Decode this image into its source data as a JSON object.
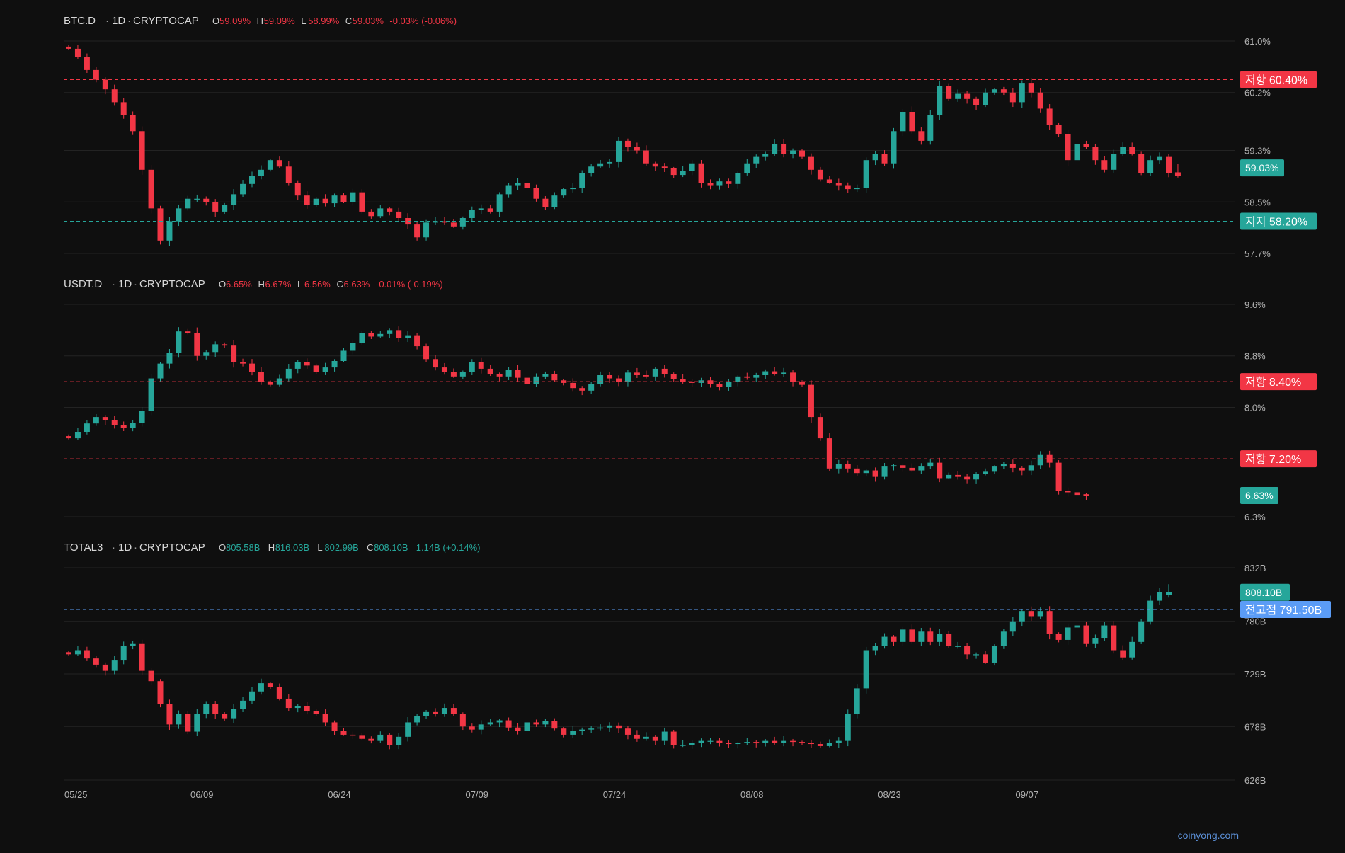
{
  "theme": {
    "up": "#26a69a",
    "down": "#f23645",
    "grid": "#232323",
    "axis_text": "#b2b2b2",
    "support_color": "#26a69a",
    "resistance_color": "#f23645",
    "prev_high_color": "#5b9cf6"
  },
  "x_axis": {
    "labels": [
      "05/25",
      "06/09",
      "06/24",
      "07/09",
      "07/24",
      "08/08",
      "08/23",
      "09/07"
    ],
    "label_index": [
      0,
      15,
      30,
      45,
      60,
      75,
      90,
      105
    ]
  },
  "watermark": "coinyong.com",
  "chart_data": [
    {
      "type": "candlestick",
      "symbol": "BTC.D",
      "interval": "1D",
      "exchange": "CRYPTOCAP",
      "ohlc_label": {
        "o": "59.09%",
        "h": "59.09%",
        "l": "58.99%",
        "c": "59.03%",
        "chg": "-0.03% (-0.06%)",
        "direction": "down"
      },
      "y_ticks": [
        {
          "v": 61.0,
          "label": "61.0%"
        },
        {
          "v": 60.2,
          "label": "60.2%"
        },
        {
          "v": 59.3,
          "label": "59.3%"
        },
        {
          "v": 58.5,
          "label": "58.5%"
        },
        {
          "v": 57.7,
          "label": "57.7%"
        }
      ],
      "ylim": [
        57.7,
        61.0
      ],
      "levels": [
        {
          "label": "저항 60.40%",
          "value": 60.4,
          "kind": "resistance"
        },
        {
          "label": "지지 58.20%",
          "value": 58.2,
          "kind": "support"
        }
      ],
      "last_price": {
        "label": "59.03%",
        "value": 59.03,
        "direction": "up"
      },
      "closes": [
        60.88,
        60.75,
        60.55,
        60.4,
        60.25,
        60.05,
        59.85,
        59.6,
        59.0,
        58.4,
        57.9,
        58.2,
        58.4,
        58.55,
        58.55,
        58.5,
        58.35,
        58.45,
        58.62,
        58.78,
        58.9,
        59.0,
        59.15,
        59.05,
        58.8,
        58.6,
        58.45,
        58.55,
        58.48,
        58.6,
        58.5,
        58.65,
        58.35,
        58.28,
        58.4,
        58.35,
        58.25,
        58.15,
        57.95,
        58.18,
        58.2,
        58.18,
        58.12,
        58.25,
        58.38,
        58.4,
        58.35,
        58.62,
        58.75,
        58.8,
        58.72,
        58.55,
        58.42,
        58.6,
        58.7,
        58.72,
        58.95,
        59.05,
        59.1,
        59.12,
        59.45,
        59.35,
        59.3,
        59.1,
        59.05,
        59.02,
        58.92,
        58.98,
        59.1,
        58.8,
        58.75,
        58.82,
        58.78,
        58.95,
        59.1,
        59.2,
        59.25,
        59.4,
        59.25,
        59.3,
        59.2,
        59.0,
        58.85,
        58.8,
        58.75,
        58.7,
        58.72,
        59.15,
        59.25,
        59.1,
        59.6,
        59.9,
        59.6,
        59.45,
        59.85,
        60.3,
        60.1,
        60.18,
        60.1,
        60.0,
        60.2,
        60.25,
        60.2,
        60.05,
        60.35,
        60.2,
        59.95,
        59.7,
        59.55,
        59.15,
        59.4,
        59.35,
        59.15,
        59.0,
        59.25,
        59.35,
        59.25,
        58.95,
        59.15,
        59.2,
        58.95,
        58.9
      ],
      "last_candle": {
        "o": 58.96,
        "h": 59.09,
        "l": 58.88,
        "c": 58.9
      }
    },
    {
      "type": "candlestick",
      "symbol": "USDT.D",
      "interval": "1D",
      "exchange": "CRYPTOCAP",
      "ohlc_label": {
        "o": "6.65%",
        "h": "6.67%",
        "l": "6.56%",
        "c": "6.63%",
        "chg": "-0.01% (-0.19%)",
        "direction": "down"
      },
      "y_ticks": [
        {
          "v": 9.6,
          "label": "9.6%"
        },
        {
          "v": 8.8,
          "label": "8.8%"
        },
        {
          "v": 8.0,
          "label": "8.0%"
        },
        {
          "v": 6.3,
          "label": "6.3%"
        }
      ],
      "ylim": [
        6.3,
        9.6
      ],
      "levels": [
        {
          "label": "저항 8.40%",
          "value": 8.4,
          "kind": "resistance"
        },
        {
          "label": "저항 7.20%",
          "value": 7.2,
          "kind": "resistance"
        }
      ],
      "last_price": {
        "label": "6.63%",
        "value": 6.63,
        "direction": "up"
      },
      "closes": [
        7.52,
        7.62,
        7.75,
        7.85,
        7.8,
        7.72,
        7.68,
        7.76,
        7.95,
        8.45,
        8.68,
        8.85,
        9.18,
        9.16,
        8.8,
        8.86,
        8.98,
        8.96,
        8.7,
        8.68,
        8.55,
        8.4,
        8.35,
        8.45,
        8.6,
        8.7,
        8.65,
        8.55,
        8.62,
        8.72,
        8.88,
        9.0,
        9.15,
        9.1,
        9.14,
        9.2,
        9.08,
        9.12,
        8.95,
        8.75,
        8.62,
        8.55,
        8.48,
        8.55,
        8.7,
        8.6,
        8.52,
        8.48,
        8.58,
        8.46,
        8.36,
        8.48,
        8.52,
        8.42,
        8.38,
        8.3,
        8.26,
        8.36,
        8.5,
        8.45,
        8.4,
        8.54,
        8.5,
        8.48,
        8.6,
        8.52,
        8.44,
        8.4,
        8.38,
        8.42,
        8.36,
        8.32,
        8.4,
        8.48,
        8.46,
        8.5,
        8.56,
        8.52,
        8.54,
        8.4,
        8.35,
        7.85,
        7.52,
        7.05,
        7.12,
        7.05,
        6.98,
        7.02,
        6.92,
        7.08,
        7.1,
        7.06,
        7.02,
        7.08,
        7.14,
        6.9,
        6.95,
        6.92,
        6.88,
        6.96,
        7.0,
        7.08,
        7.12,
        7.06,
        7.02,
        7.1,
        7.26,
        7.14,
        6.7,
        6.68,
        6.64,
        6.63
      ],
      "last_candle": {
        "o": 6.65,
        "h": 6.67,
        "l": 6.56,
        "c": 6.63
      }
    },
    {
      "type": "candlestick",
      "symbol": "TOTAL3",
      "interval": "1D",
      "exchange": "CRYPTOCAP",
      "ohlc_label": {
        "o": "805.58B",
        "h": "816.03B",
        "l": "802.99B",
        "c": "808.10B",
        "chg": "1.14B (+0.14%)",
        "direction": "up"
      },
      "y_ticks": [
        {
          "v": 832,
          "label": "832B"
        },
        {
          "v": 780,
          "label": "780B"
        },
        {
          "v": 729,
          "label": "729B"
        },
        {
          "v": 678,
          "label": "678B"
        },
        {
          "v": 626,
          "label": "626B"
        }
      ],
      "ylim": [
        626,
        832
      ],
      "levels": [
        {
          "label": "전고점 791.50B",
          "value": 791.5,
          "kind": "prev_high"
        }
      ],
      "last_price": {
        "label": "808.10B",
        "value": 808.1,
        "direction": "up"
      },
      "closes": [
        748,
        752,
        744,
        738,
        732,
        742,
        756,
        758,
        732,
        722,
        700,
        680,
        690,
        673,
        690,
        700,
        690,
        686,
        695,
        703,
        712,
        720,
        716,
        705,
        696,
        698,
        693,
        690,
        682,
        674,
        670,
        669,
        666,
        664,
        670,
        660,
        668,
        682,
        688,
        692,
        690,
        696,
        690,
        678,
        675,
        680,
        682,
        684,
        677,
        674,
        682,
        680,
        683,
        676,
        670,
        674,
        675,
        676,
        677,
        679,
        676,
        670,
        666,
        668,
        664,
        673,
        660,
        660,
        662,
        664,
        664,
        662,
        661,
        662,
        663,
        662,
        664,
        662,
        664,
        663,
        662,
        661,
        659,
        662,
        664,
        690,
        715,
        752,
        756,
        765,
        760,
        772,
        760,
        770,
        760,
        768,
        756,
        756,
        748,
        748,
        740,
        756,
        770,
        780,
        790,
        785,
        790,
        768,
        762,
        774,
        776,
        758,
        764,
        776,
        752,
        745,
        760,
        780,
        800,
        808,
        808
      ],
      "last_candle": {
        "o": 805.58,
        "h": 816.03,
        "l": 802.99,
        "c": 808.1
      }
    }
  ]
}
